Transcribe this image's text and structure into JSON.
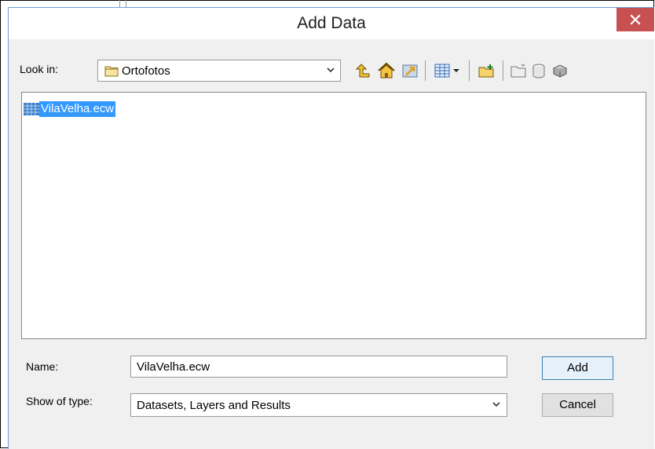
{
  "dialog": {
    "title": "Add Data",
    "close_symbol": "✕"
  },
  "look_in": {
    "label": "Look in:",
    "value": "Ortofotos"
  },
  "toolbar": {
    "icons": [
      "up-one-level-icon",
      "home-icon",
      "go-to-default-geodatabase-icon",
      "details-view-icon",
      "view-dropdown-icon",
      "connect-to-folder-icon",
      "new-folder-icon",
      "new-geodatabase-icon",
      "new-feature-dataset-icon"
    ]
  },
  "files": [
    {
      "name": "VilaVelha.ecw",
      "selected": true,
      "icon": "raster-dataset-icon"
    }
  ],
  "name_field": {
    "label": "Name:",
    "value": "VilaVelha.ecw"
  },
  "type_field": {
    "label": "Show of type:",
    "value": "Datasets, Layers and Results"
  },
  "buttons": {
    "add": "Add",
    "cancel": "Cancel"
  },
  "colors": {
    "selection": "#3399ff",
    "close_button": "#c75050",
    "frame_accent": "#6f9fd8"
  }
}
